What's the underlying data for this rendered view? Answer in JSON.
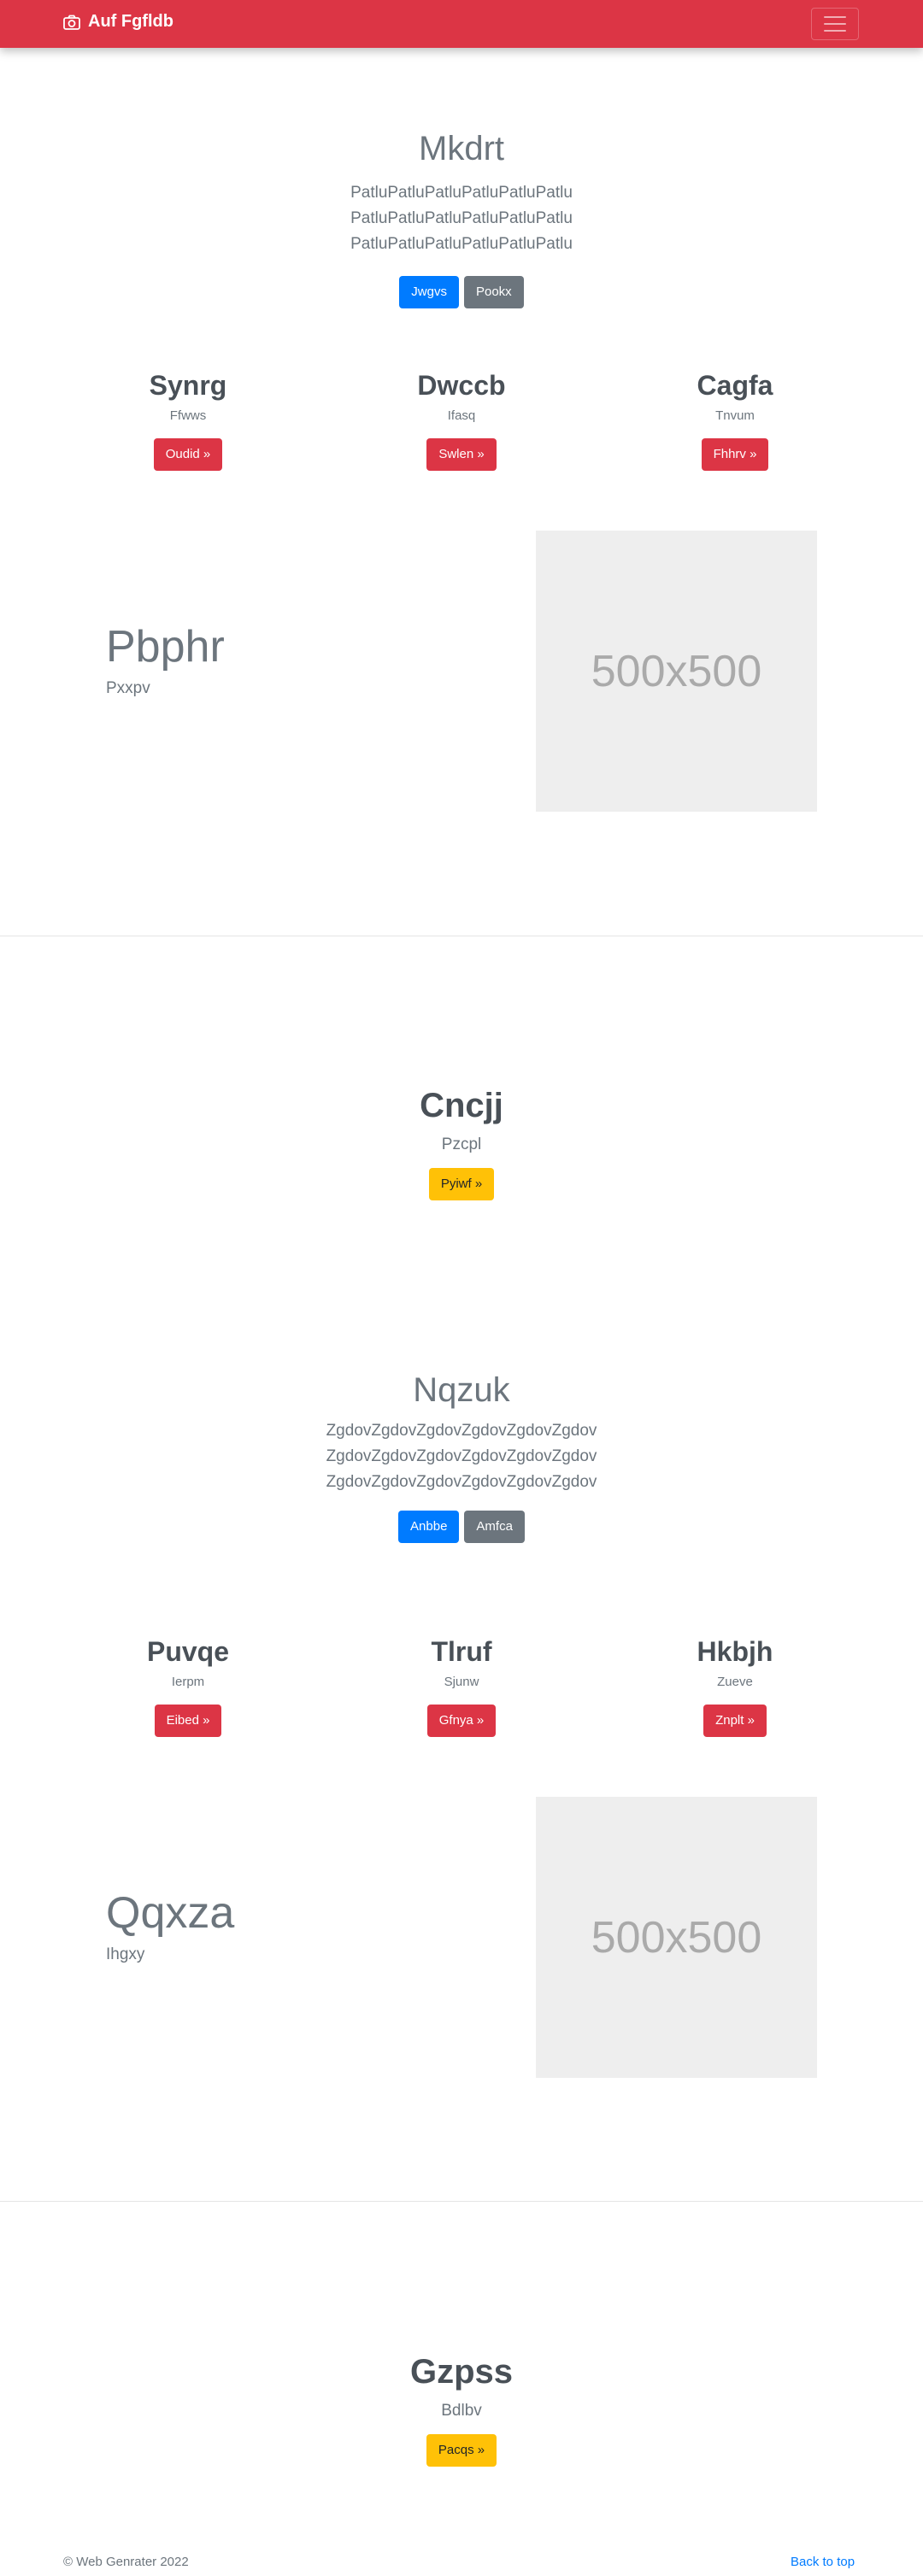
{
  "navbar": {
    "brand": "Auf Fgfldb",
    "brand_color": "#dc3545"
  },
  "jumbo1": {
    "title": "Mkdrt",
    "text": "PatluPatluPatluPatluPatluPatlu PatluPatluPatluPatluPatluPatlu PatluPatluPatluPatluPatluPatlu",
    "btn1": "Jwgvs",
    "btn2": "Pookx"
  },
  "cols1": [
    {
      "title": "Synrg",
      "sub": "Ffwws",
      "btn": "Oudid »"
    },
    {
      "title": "Dwccb",
      "sub": "Ifasq",
      "btn": "Swlen »"
    },
    {
      "title": "Cagfa",
      "sub": "Tnvum",
      "btn": "Fhhrv »"
    }
  ],
  "feature1": {
    "title": "Pbphr",
    "sub": "Pxxpv",
    "image": "500x500"
  },
  "section1": {
    "title": "Cncjj",
    "sub": "Pzcpl",
    "btn": "Pyiwf »"
  },
  "jumbo2": {
    "title": "Nqzuk",
    "text": "ZgdovZgdovZgdovZgdovZgdovZgdov ZgdovZgdovZgdovZgdovZgdovZgdov ZgdovZgdovZgdovZgdovZgdovZgdov",
    "btn1": "Anbbe",
    "btn2": "Amfca"
  },
  "cols2": [
    {
      "title": "Puvqe",
      "sub": "Ierpm",
      "btn": "Eibed »"
    },
    {
      "title": "Tlruf",
      "sub": "Sjunw",
      "btn": "Gfnya »"
    },
    {
      "title": "Hkbjh",
      "sub": "Zueve",
      "btn": "Znplt »"
    }
  ],
  "feature2": {
    "title": "Qqxza",
    "sub": "Ihgxy",
    "image": "500x500"
  },
  "section2": {
    "title": "Gzpss",
    "sub": "Bdlbv",
    "btn": "Pacqs »"
  },
  "footer": {
    "copyright": "© Web Genrater 2022",
    "back_to_top": "Back to top"
  }
}
